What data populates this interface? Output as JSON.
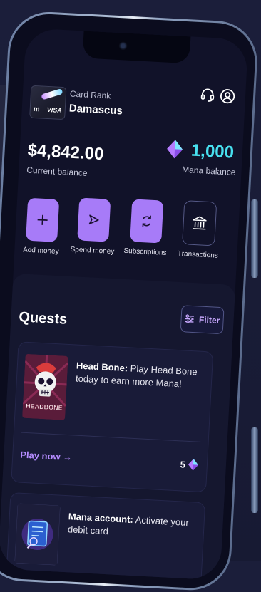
{
  "card": {
    "brand": "m",
    "network": "VISA",
    "rank_label": "Card Rank",
    "rank_value": "Damascus"
  },
  "balance": {
    "amount": "$4,842.00",
    "label": "Current balance"
  },
  "mana": {
    "amount": "1,000",
    "label": "Mana balance"
  },
  "actions": [
    {
      "label": "Add money"
    },
    {
      "label": "Spend money"
    },
    {
      "label": "Subscriptions"
    },
    {
      "label": "Transactions"
    }
  ],
  "quests": {
    "title": "Quests",
    "filter_label": "Filter",
    "items": [
      {
        "image_text": "HEADBONE",
        "title": "Head Bone:",
        "description": "Play Head Bone today to earn more Mana!",
        "cta": "Play now",
        "reward": "5"
      },
      {
        "title": "Mana account:",
        "description": "Activate your debit card"
      }
    ]
  },
  "colors": {
    "accent": "#a77bf8",
    "mana": "#48e0ef",
    "background": "#111229"
  }
}
